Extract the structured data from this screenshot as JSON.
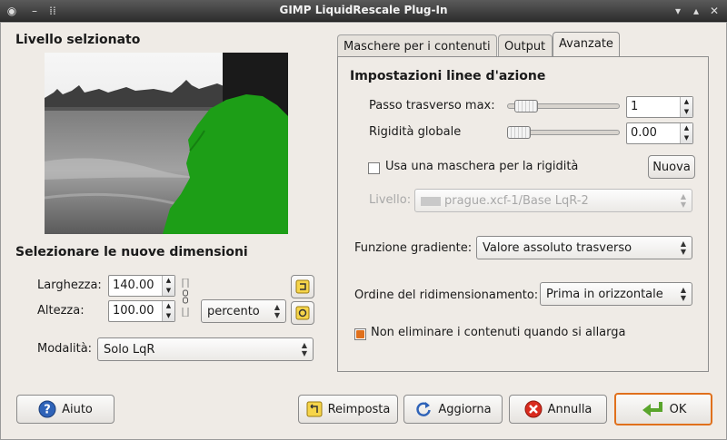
{
  "window": {
    "title": "GIMP LiquidRescale Plug-In"
  },
  "left": {
    "selected_layer_title": "Livello selzionato",
    "new_size_title": "Selezionare le nuove dimensioni",
    "width_label": "Larghezza:",
    "width_value": "140.00",
    "height_label": "Altezza:",
    "height_value": "100.00",
    "unit_value": "percento",
    "mode_label": "Modalità:",
    "mode_value": "Solo LqR"
  },
  "tabs": [
    {
      "label": "Maschere per i contenuti"
    },
    {
      "label": "Output"
    },
    {
      "label": "Avanzate"
    }
  ],
  "advanced": {
    "section_title": "Impostazioni linee d'azione",
    "max_step_label": "Passo trasverso max:",
    "max_step_value": "1",
    "max_step_level": 0.0,
    "rigidity_label": "Rigidità globale",
    "rigidity_value": "0.00",
    "rigidity_level": 0.0,
    "rigidity_mask_label": "Usa una maschera per la rigidità",
    "rigidity_mask_checked": false,
    "new_button": "Nuova",
    "layer_label": "Livello:",
    "layer_value": "prague.xcf-1/Base LqR-2",
    "gradient_label": "Funzione gradiente:",
    "gradient_value": "Valore assoluto trasverso",
    "order_label": "Ordine del ridimensionamento:",
    "order_value": "Prima in orizzontale",
    "no_discard_label": "Non eliminare i contenuti quando si allarga",
    "no_discard_checked": true
  },
  "buttons": {
    "help": "Aiuto",
    "reset": "Reimposta",
    "refresh": "Aggiorna",
    "cancel": "Annulla",
    "ok": "OK"
  },
  "colors": {
    "accent": "#e0701c",
    "mask_green": "#1d9e17"
  }
}
